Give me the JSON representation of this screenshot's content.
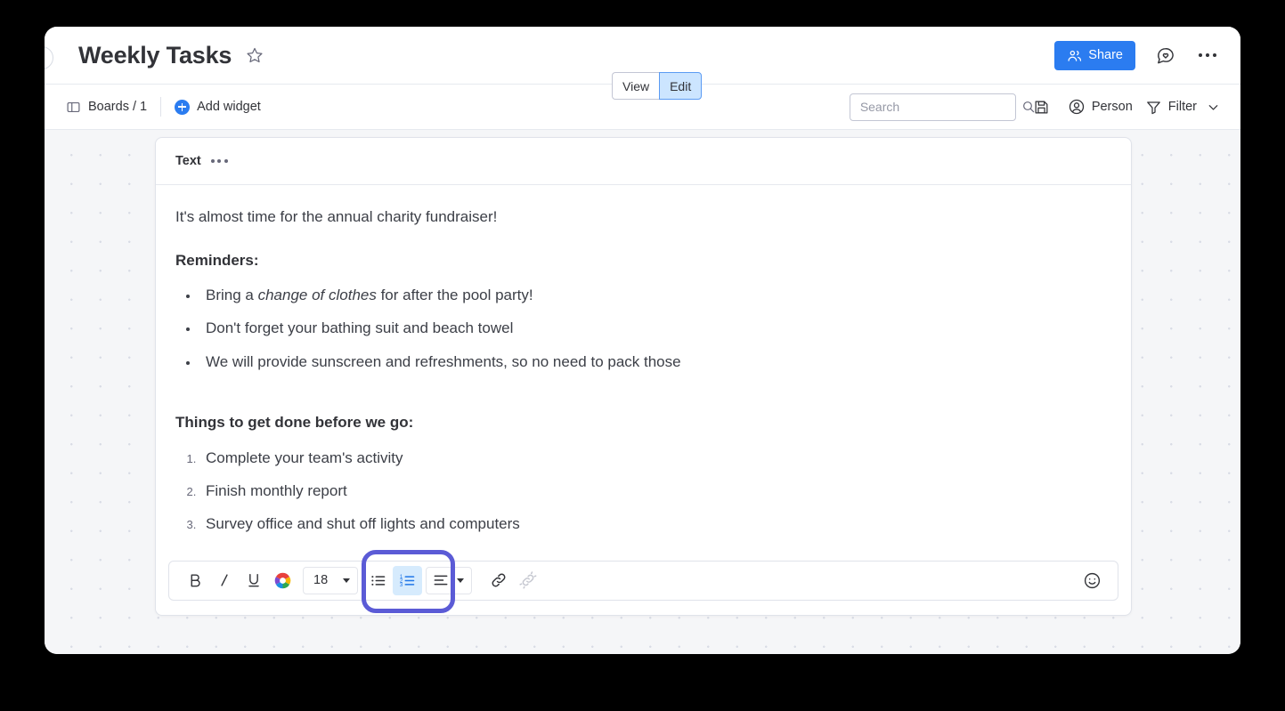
{
  "header": {
    "title": "Weekly Tasks",
    "star_icon": "star-outline-icon",
    "collapse_icon": "collapse-circle-icon",
    "view_label": "View",
    "edit_label": "Edit",
    "active_mode": "Edit",
    "share_label": "Share",
    "share_icon": "people-icon",
    "feedback_icon": "speech-bubble-heart-icon",
    "more_icon": "more-horizontal-icon",
    "share_bg_color": "#2b7cf0",
    "edit_active_bg_color": "#cce5ff"
  },
  "subbar": {
    "boards_label": "Boards / 1",
    "boards_icon": "board-layout-icon",
    "add_widget_label": "Add widget",
    "add_widget_icon": "plus-circle-icon",
    "search_placeholder": "Search",
    "search_value": "",
    "search_icon": "magnifier-icon",
    "save_icon": "floppy-disk-icon",
    "person_label": "Person",
    "person_icon": "user-circle-icon",
    "filter_label": "Filter",
    "filter_icon": "funnel-icon",
    "filter_chevron_icon": "chevron-down-icon"
  },
  "widget": {
    "title": "Text",
    "menu_icon": "more-horizontal-icon",
    "intro": "It's almost time for the annual charity fundraiser!",
    "reminders_heading": "Reminders:",
    "reminders": [
      {
        "prefix": "Bring a ",
        "emphasis": "change of clothes",
        "suffix": " for after the pool party!"
      },
      {
        "prefix": "Don't forget your bathing suit and beach towel",
        "emphasis": "",
        "suffix": ""
      },
      {
        "prefix": "We will provide sunscreen and refreshments, so no need to pack those",
        "emphasis": "",
        "suffix": ""
      }
    ],
    "todo_heading": "Things to get done before we go:",
    "todos": [
      "Complete your team's activity",
      "Finish monthly report",
      "Survey office and shut off lights and computers"
    ]
  },
  "editor_toolbar": {
    "bold_label": "B",
    "italic_label": "I",
    "underline_label": "U",
    "bold_icon": "bold-icon",
    "italic_icon": "italic-icon",
    "underline_icon": "underline-icon",
    "color_icon": "color-wheel-icon",
    "font_size_value": "18",
    "font_size_caret_icon": "caret-down-icon",
    "bullet_list_icon": "bulleted-list-icon",
    "numbered_list_icon": "numbered-list-icon",
    "numbered_list_active": true,
    "align_icon": "text-align-icon",
    "align_caret_icon": "caret-down-icon",
    "link_icon": "link-icon",
    "unlink_icon": "unlink-icon",
    "unlink_disabled": true,
    "emoji_icon": "smiley-face-icon",
    "active_highlight_color": "#5b5bd6",
    "active_button_bg": "#d6ebfd"
  }
}
